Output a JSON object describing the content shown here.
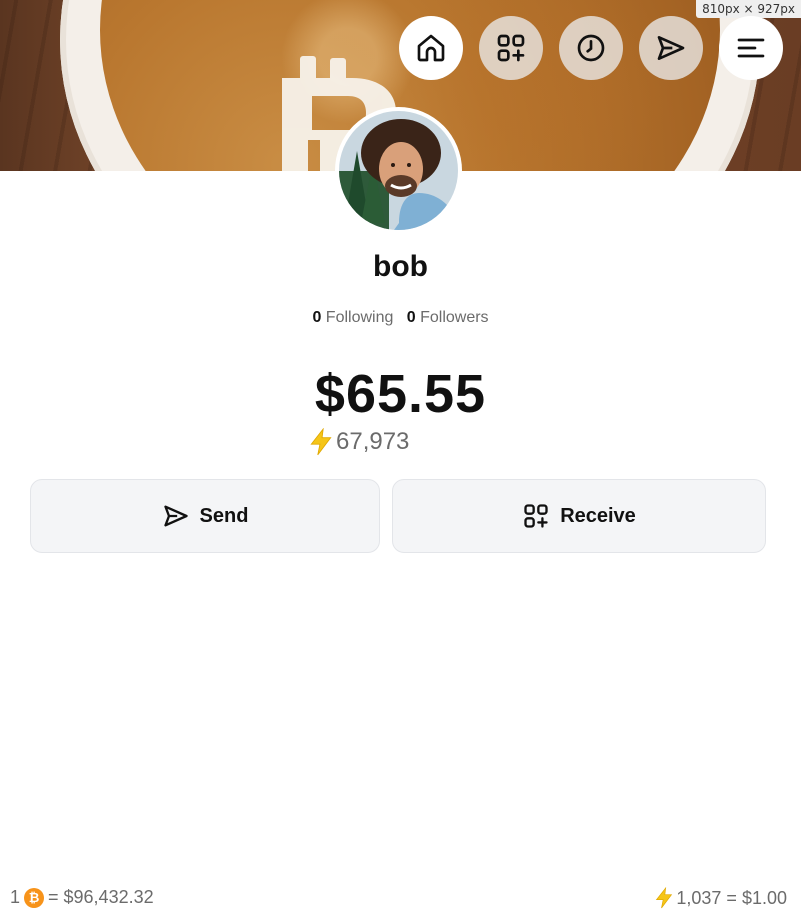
{
  "badge": {
    "size_label": "810px × 927px"
  },
  "nav": [
    {
      "name": "home",
      "icon": "home-icon"
    },
    {
      "name": "receive",
      "icon": "qr-plus-icon"
    },
    {
      "name": "history",
      "icon": "clock-icon"
    },
    {
      "name": "send",
      "icon": "send-icon"
    },
    {
      "name": "menu",
      "icon": "menu-icon"
    }
  ],
  "profile": {
    "username": "bob",
    "following_count": "0",
    "following_label": "Following",
    "followers_count": "0",
    "followers_label": "Followers"
  },
  "wallet": {
    "balance": "$65.55",
    "sats": "67,973",
    "sats_icon": "lightning-icon"
  },
  "actions": {
    "send_label": "Send",
    "receive_label": "Receive"
  },
  "footer": {
    "btc_amount": "1",
    "btc_equals": "= $96,432.32",
    "sats_rate": "1,037 = $1.00"
  },
  "colors": {
    "bitcoin_orange": "#f7931a",
    "lightning_yellow": "#f5c518",
    "text_muted": "#6b6b6b"
  }
}
